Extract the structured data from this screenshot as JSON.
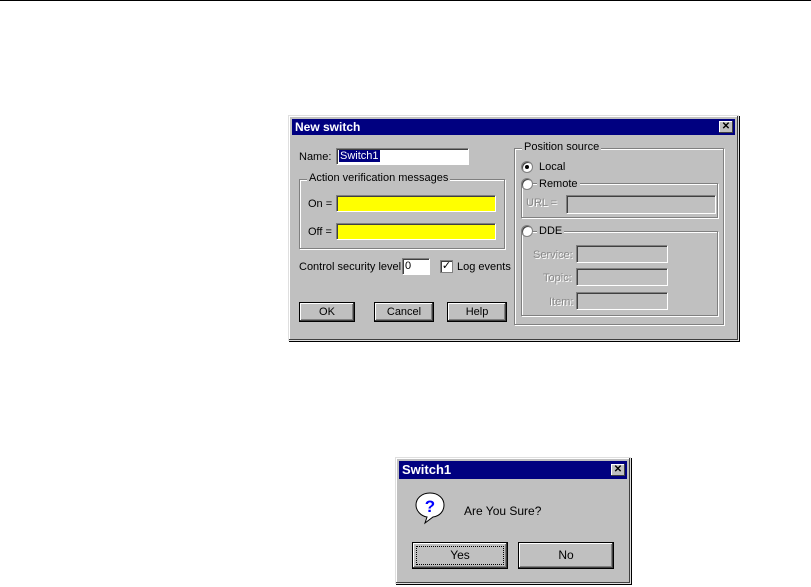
{
  "new_switch": {
    "title": "New switch",
    "close": "✕",
    "name_label": "Name:",
    "name_value": "Switch1",
    "action_group_label": "Action verification messages",
    "on_label": "On =",
    "on_value": "",
    "off_label": "Off =",
    "off_value": "",
    "security_label": "Control security level:",
    "security_value": "0",
    "log_events_label": "Log events",
    "log_events_checked": true,
    "ok": "OK",
    "cancel": "Cancel",
    "help": "Help",
    "position_group_label": "Position source",
    "local_label": "Local",
    "remote_label": "Remote",
    "url_label": "URL =",
    "dde_label": "DDE",
    "service_label": "Service:",
    "topic_label": "Topic:",
    "item_label": "Item:",
    "selected_source": "Local"
  },
  "confirm": {
    "title": "Switch1",
    "close": "✕",
    "message": "Are You Sure?",
    "icon": "question-icon",
    "yes": "Yes",
    "no": "No"
  },
  "colors": {
    "titlebar": "#000080",
    "face": "#c0c0c0",
    "highlight_field": "#ffff00"
  }
}
